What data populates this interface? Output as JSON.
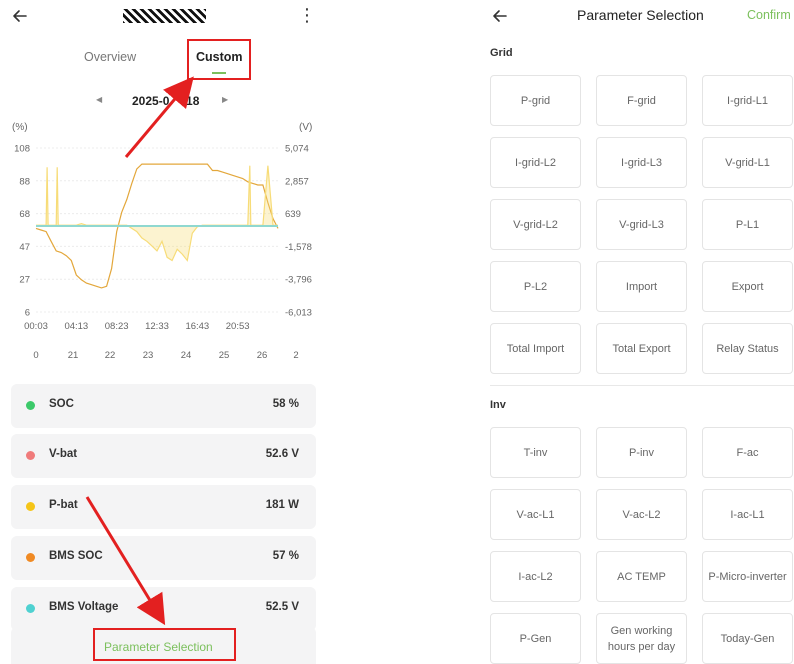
{
  "left": {
    "tabs": {
      "overview": "Overview",
      "custom": "Custom"
    },
    "date": "2025-0     18",
    "chart_data": {
      "type": "line",
      "left_axis_unit": "(%)",
      "right_axis_unit": "(V)",
      "left_ticks": [
        "108",
        "88",
        "68",
        "47",
        "27",
        "6"
      ],
      "right_ticks": [
        "5,074",
        "2,857",
        "639",
        "-1,578",
        "-3,796",
        "-6,013"
      ],
      "time_ticks": [
        "00:03",
        "04:13",
        "08:23",
        "12:33",
        "16:43",
        "20:53"
      ],
      "day_ticks": [
        "0",
        "21",
        "22",
        "23",
        "24",
        "25",
        "26",
        "2"
      ],
      "ylim_left": [
        6,
        108
      ],
      "ylim_right": [
        -6013,
        5074
      ],
      "series": [
        {
          "color": "#e3a73b",
          "axis": "left",
          "x": [
            0,
            0.5,
            1,
            1.5,
            2,
            2.5,
            3,
            3.5,
            4,
            4.5,
            5,
            5.5,
            6,
            6.5,
            7,
            7.5,
            8,
            8.5,
            9,
            9.5,
            10,
            10.5,
            11,
            11.5,
            12,
            12.5,
            13,
            13.5,
            14,
            14.5,
            15,
            15.5,
            16,
            16.5,
            17,
            17.5,
            18,
            18.5,
            19,
            19.5,
            20,
            20.5,
            21,
            21.5,
            22,
            22.5,
            23,
            23.5,
            24
          ],
          "values": [
            58,
            57,
            56,
            50,
            44,
            43,
            41,
            38,
            29,
            26,
            24,
            23,
            22,
            21,
            22,
            33,
            56,
            68,
            76,
            86,
            95,
            98,
            98,
            98,
            98,
            98,
            98,
            98,
            98,
            98,
            98,
            98,
            98,
            98,
            98,
            94,
            94,
            93,
            92,
            91,
            90,
            89,
            87,
            86,
            85,
            85,
            74,
            64,
            58
          ]
        },
        {
          "color": "#f7dc78",
          "axis": "left",
          "x": [
            0,
            1,
            1.1,
            1.2,
            1.3,
            2,
            2.1,
            2.2,
            2.3,
            3,
            4,
            4.5,
            5,
            5.5,
            6,
            6.5,
            7,
            7.5,
            8,
            8.5,
            9,
            9.5,
            10,
            10.5,
            11,
            11.5,
            12,
            12.5,
            13,
            13.5,
            14,
            14.5,
            15,
            15.5,
            16,
            16.5,
            17,
            17.5,
            18,
            18.5,
            19,
            19.5,
            20,
            20.5,
            21,
            21.2,
            21.3,
            21.4,
            22,
            22.5,
            23,
            23.5,
            24
          ],
          "values": [
            60,
            60,
            96,
            60,
            60,
            60,
            96,
            60,
            60,
            60,
            60,
            61,
            60,
            60,
            60,
            60,
            60,
            60,
            60,
            60,
            60,
            58,
            56,
            52,
            50,
            47,
            44,
            50,
            40,
            38,
            45,
            42,
            38,
            55,
            59,
            60,
            60,
            60,
            60,
            60,
            60,
            60,
            60,
            60,
            60,
            97,
            60,
            60,
            60,
            60,
            97,
            60,
            60
          ]
        },
        {
          "color": "#8fd8d0",
          "axis": "left",
          "x": [
            0,
            24
          ],
          "values": [
            59.5,
            59.5
          ]
        }
      ]
    },
    "params": [
      {
        "name": "SOC",
        "value": "58 %",
        "color": "#3cc96a"
      },
      {
        "name": "V-bat",
        "value": "52.6 V",
        "color": "#f07b7b"
      },
      {
        "name": "P-bat",
        "value": "181 W",
        "color": "#f5c518"
      },
      {
        "name": "BMS SOC",
        "value": "57 %",
        "color": "#f08a24"
      },
      {
        "name": "BMS Voltage",
        "value": "52.5 V",
        "color": "#4fd1d1"
      }
    ],
    "param_selection_label": "Parameter Selection"
  },
  "right": {
    "title": "Parameter Selection",
    "confirm": "Confirm",
    "sections": [
      {
        "title": "Grid",
        "options": [
          "P-grid",
          "F-grid",
          "I-grid-L1",
          "I-grid-L2",
          "I-grid-L3",
          "V-grid-L1",
          "V-grid-L2",
          "V-grid-L3",
          "P-L1",
          "P-L2",
          "Import",
          "Export",
          "Total Import",
          "Total Export",
          "Relay Status"
        ]
      },
      {
        "title": "Inv",
        "options": [
          "T-inv",
          "P-inv",
          "F-ac",
          "V-ac-L1",
          "V-ac-L2",
          "I-ac-L1",
          "I-ac-L2",
          "AC TEMP",
          "P-Micro-inverter",
          "P-Gen",
          "Gen working hours per day",
          "Today-Gen"
        ]
      }
    ]
  },
  "colors": {
    "accent": "#7cc05d",
    "annotation_red": "#e32020"
  }
}
